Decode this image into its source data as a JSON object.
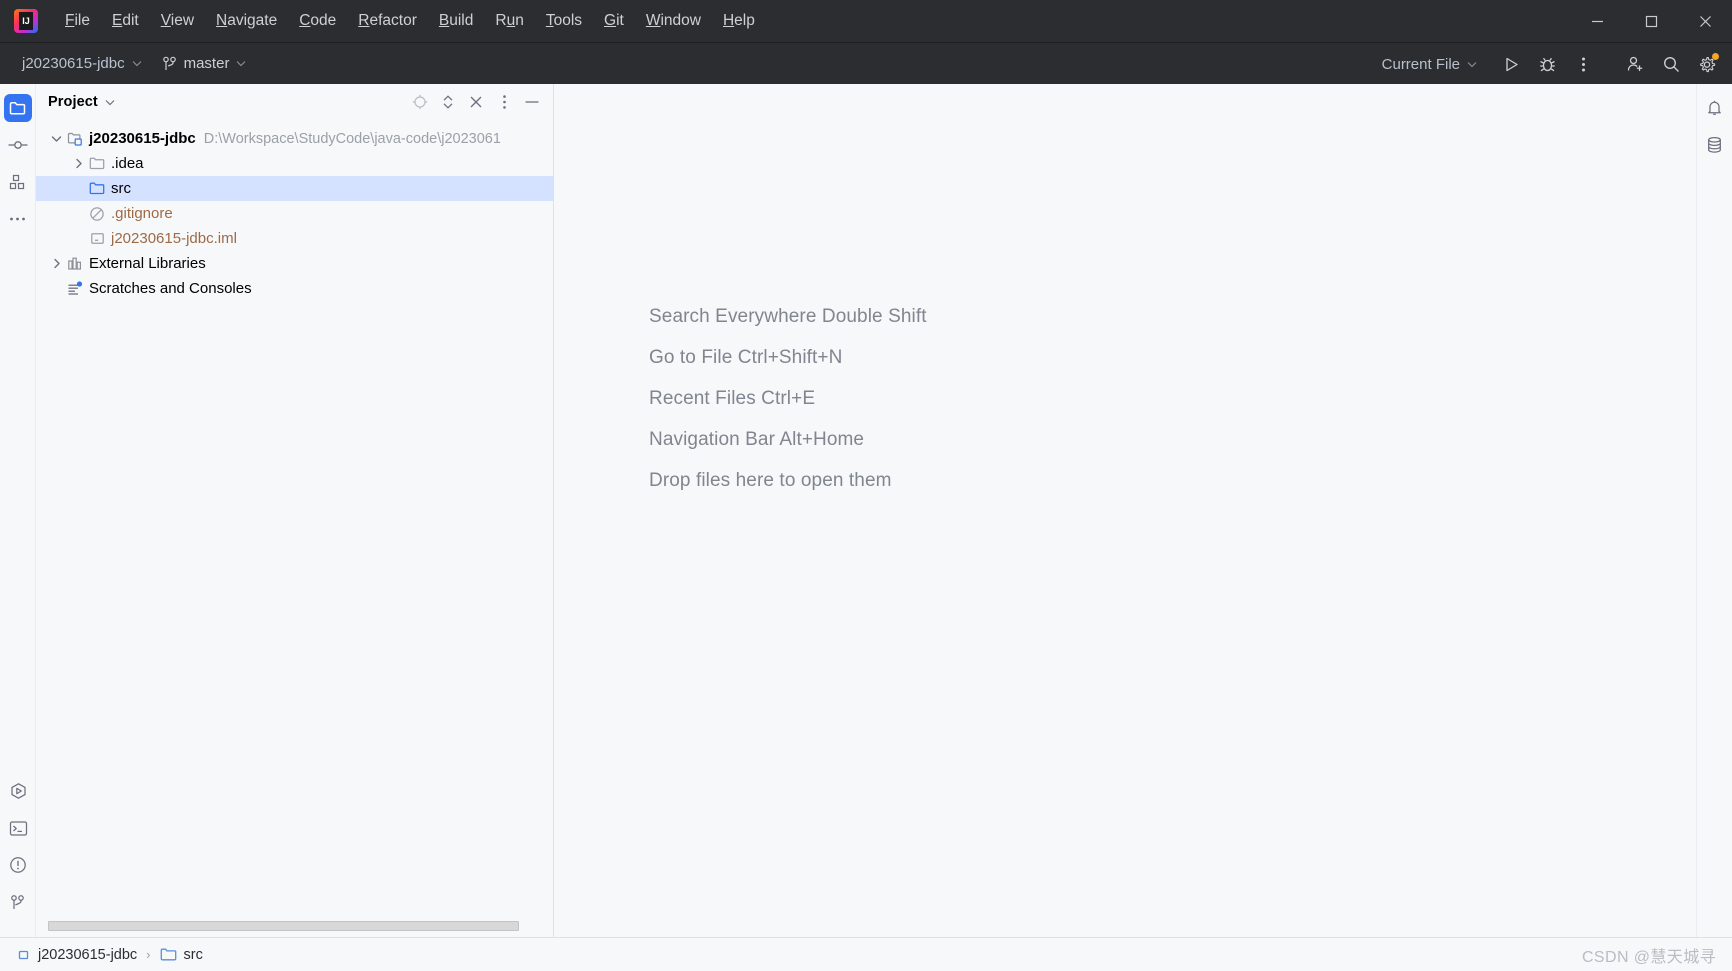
{
  "window": {
    "controls": {
      "minimize": "minimize-button",
      "maximize": "maximize-button",
      "close": "close-button"
    }
  },
  "menubar": {
    "logo_text": "IJ",
    "items": [
      {
        "label": "File",
        "mnemonic": "F",
        "rest": "ile"
      },
      {
        "label": "Edit",
        "mnemonic": "E",
        "rest": "dit"
      },
      {
        "label": "View",
        "mnemonic": "V",
        "rest": "iew"
      },
      {
        "label": "Navigate",
        "mnemonic": "N",
        "rest": "avigate"
      },
      {
        "label": "Code",
        "mnemonic": "C",
        "rest": "ode"
      },
      {
        "label": "Refactor",
        "mnemonic": "R",
        "rest": "efactor"
      },
      {
        "label": "Build",
        "mnemonic": "B",
        "rest": "uild"
      },
      {
        "label": "Run",
        "mnemonic": "u",
        "pre": "R",
        "rest": "n"
      },
      {
        "label": "Tools",
        "mnemonic": "T",
        "rest": "ools"
      },
      {
        "label": "Git",
        "mnemonic": "G",
        "rest": "it"
      },
      {
        "label": "Window",
        "mnemonic": "W",
        "rest": "indow"
      },
      {
        "label": "Help",
        "mnemonic": "H",
        "rest": "elp"
      }
    ]
  },
  "navbar": {
    "project_name": "j20230615-jdbc",
    "branch": "master",
    "run_config": "Current File",
    "icons": [
      "run-icon",
      "debug-icon",
      "more-actions-icon",
      "add-user-icon",
      "search-icon",
      "settings-icon"
    ],
    "settings_badge": true
  },
  "left_stripe": {
    "top": [
      {
        "name": "project-tool-window",
        "icon": "folder-icon",
        "active": true
      },
      {
        "name": "commit-tool-window",
        "icon": "commit-icon",
        "active": false
      },
      {
        "name": "structure-tool-window",
        "icon": "structure-icon",
        "active": false
      },
      {
        "name": "more-tool-windows",
        "icon": "ellipsis-icon",
        "active": false
      }
    ],
    "bottom": [
      {
        "name": "run-tool-window",
        "icon": "run-hexagon-icon"
      },
      {
        "name": "terminal-tool-window",
        "icon": "terminal-icon"
      },
      {
        "name": "problems-tool-window",
        "icon": "warning-circle-icon"
      },
      {
        "name": "git-tool-window",
        "icon": "git-branch-icon"
      }
    ]
  },
  "right_stripe": {
    "items": [
      {
        "name": "notifications-tool-window",
        "icon": "bell-icon"
      },
      {
        "name": "database-tool-window",
        "icon": "database-icon"
      }
    ]
  },
  "project_panel": {
    "title": "Project",
    "actions": [
      "select-opened-file-icon",
      "expand-collapse-icon",
      "collapse-all-icon",
      "options-icon",
      "hide-icon"
    ],
    "tree": [
      {
        "label": "j20230615-jdbc",
        "path": "D:\\Workspace\\StudyCode\\java-code\\j2023061",
        "icon": "project-module-icon",
        "indent": 0,
        "arrow": "expanded",
        "bold": true,
        "selected": false,
        "style": "normal"
      },
      {
        "label": ".idea",
        "icon": "folder-icon",
        "indent": 1,
        "arrow": "collapsed",
        "bold": false,
        "selected": false,
        "style": "normal"
      },
      {
        "label": "src",
        "icon": "source-folder-icon",
        "indent": 1,
        "arrow": "none",
        "bold": false,
        "selected": true,
        "style": "normal"
      },
      {
        "label": ".gitignore",
        "icon": "gitignore-icon",
        "indent": 1,
        "arrow": "none",
        "bold": false,
        "selected": false,
        "style": "ignored"
      },
      {
        "label": "j20230615-jdbc.iml",
        "icon": "iml-file-icon",
        "indent": 1,
        "arrow": "none",
        "bold": false,
        "selected": false,
        "style": "ignored"
      },
      {
        "label": "External Libraries",
        "icon": "library-icon",
        "indent": 0,
        "arrow": "collapsed",
        "bold": false,
        "selected": false,
        "style": "normal"
      },
      {
        "label": "Scratches and Consoles",
        "icon": "scratches-icon",
        "indent": 0,
        "arrow": "none",
        "bold": false,
        "selected": false,
        "style": "normal"
      }
    ]
  },
  "editor": {
    "tips": [
      "Search Everywhere Double Shift",
      "Go to File Ctrl+Shift+N",
      "Recent Files Ctrl+E",
      "Navigation Bar Alt+Home",
      "Drop files here to open them"
    ]
  },
  "statusbar": {
    "breadcrumb": [
      {
        "label": "j20230615-jdbc",
        "icon": "module-icon"
      },
      {
        "label": "src",
        "icon": "source-folder-icon"
      }
    ],
    "separator": "›",
    "watermark": "CSDN @慧天城寻"
  },
  "colors": {
    "dark_chrome": "#2b2d30",
    "panel_bg": "#f7f8fa",
    "selection": "#d4e2ff",
    "accent_blue": "#3574f0",
    "ignored_text": "#9e6a45",
    "tip_text": "#80858f",
    "badge_orange": "#f5a623"
  }
}
